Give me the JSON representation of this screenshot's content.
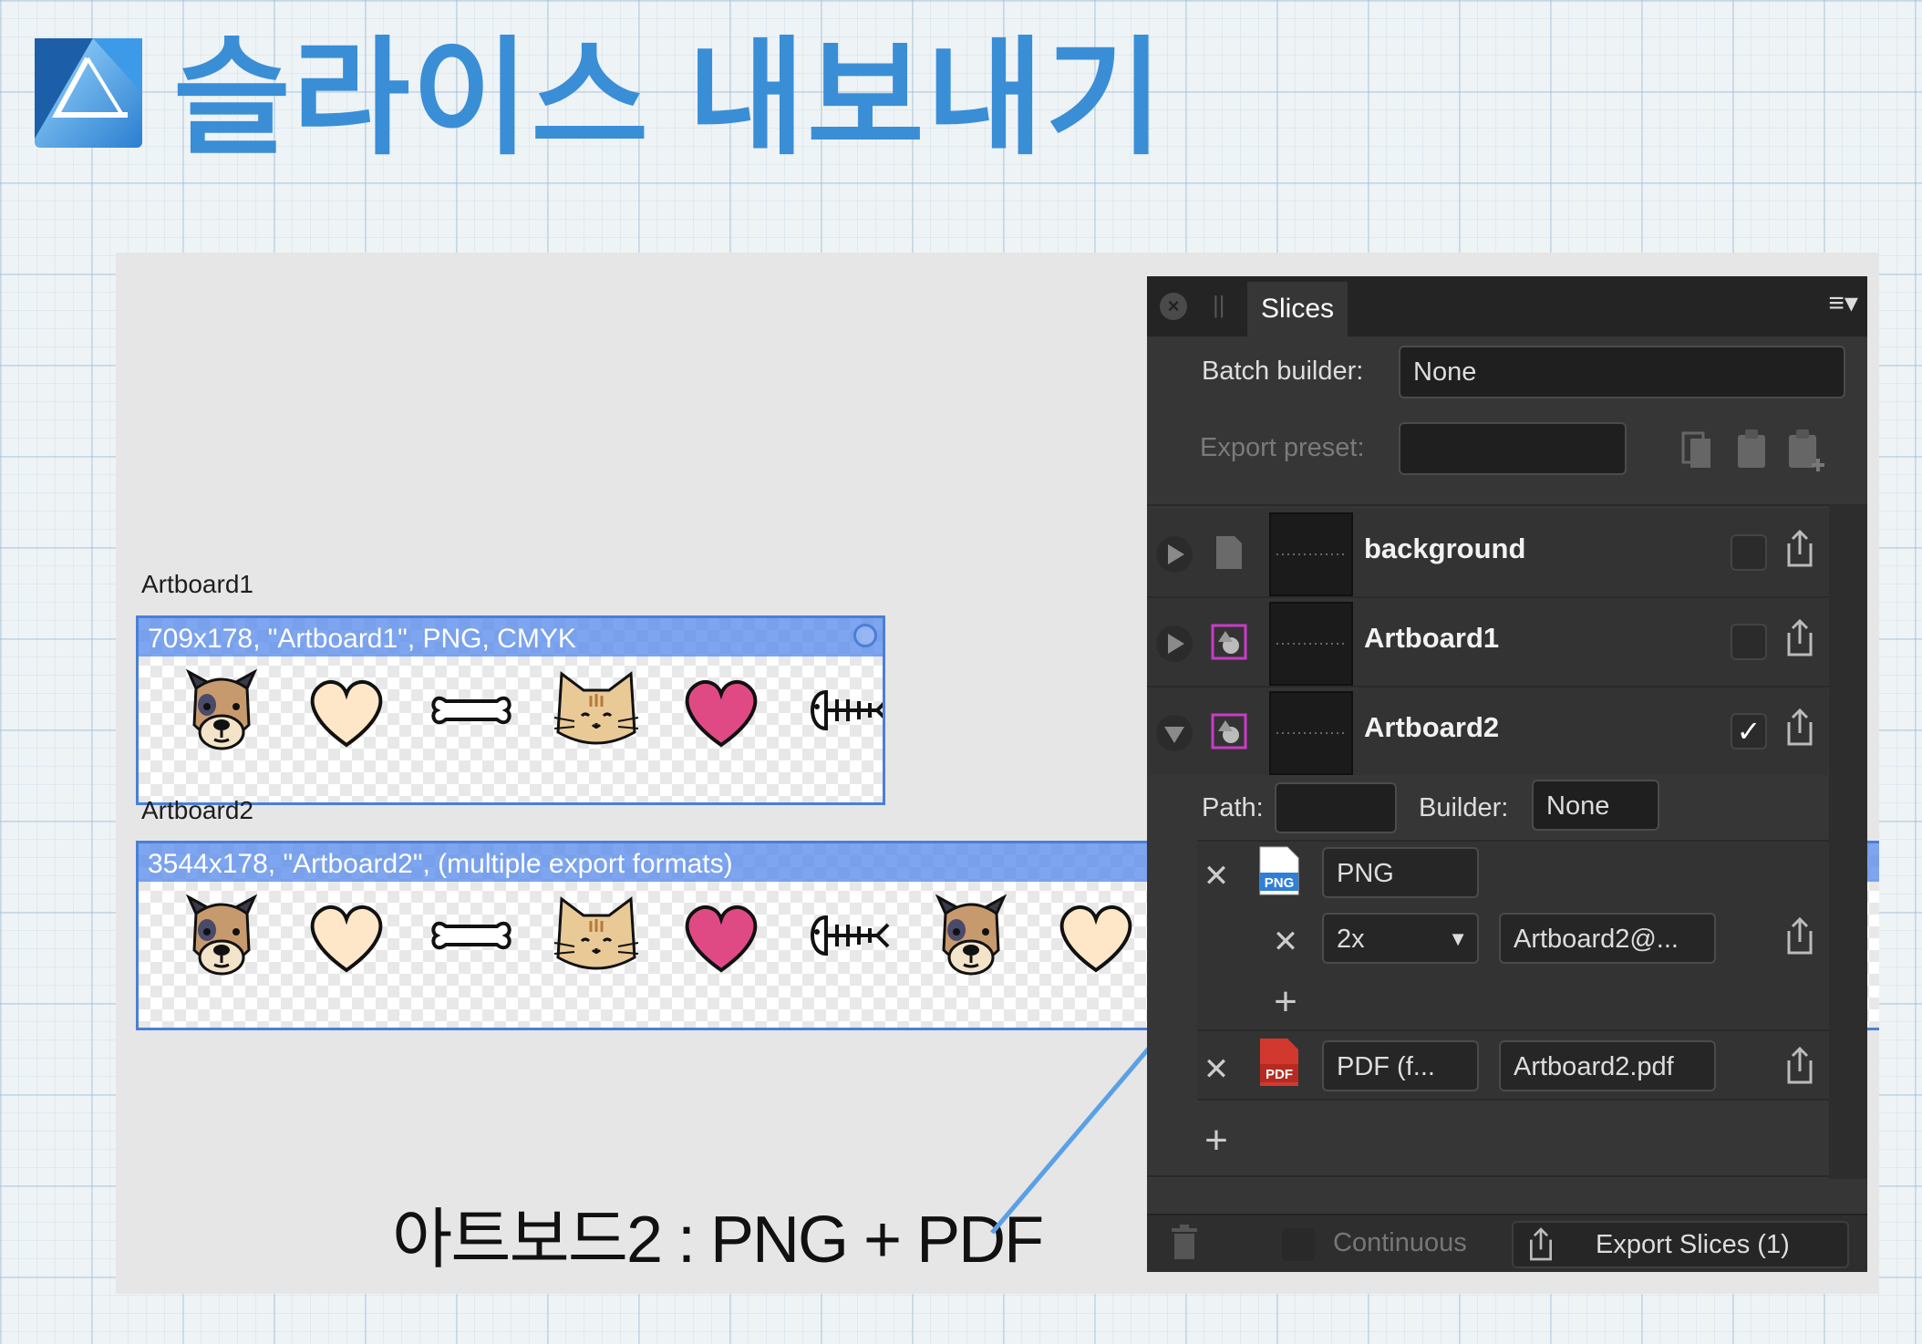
{
  "header": {
    "title": "슬라이스 내보내기"
  },
  "canvas": {
    "artboard1": {
      "label": "Artboard1",
      "info": "709x178, \"Artboard1\", PNG, CMYK"
    },
    "artboard2": {
      "label": "Artboard2",
      "info": "3544x178, \"Artboard2\", (multiple export formats)"
    },
    "icons": [
      "dog-face",
      "cream-heart",
      "bone",
      "cat-face",
      "pink-heart",
      "fish-bone"
    ]
  },
  "annotation": {
    "text": "아트보드2 : PNG + PDF",
    "line_color": "#5aa0e6"
  },
  "panel": {
    "tab": "Slices",
    "batch_builder_label": "Batch builder:",
    "batch_builder_value": "None",
    "export_preset_label": "Export preset:",
    "export_preset_value": "",
    "slices": [
      {
        "name": "background",
        "checked": false,
        "expanded": false
      },
      {
        "name": "Artboard1",
        "checked": false,
        "expanded": false
      },
      {
        "name": "Artboard2",
        "checked": true,
        "expanded": true
      }
    ],
    "path_label": "Path:",
    "path_value": "",
    "builder_label": "Builder:",
    "builder_value": "None",
    "formats": [
      {
        "icon_text": "PNG",
        "format": "PNG",
        "scale": "2x",
        "filename": "Artboard2@..."
      },
      {
        "icon_text": "PDF",
        "format": "PDF (f...",
        "filename": "Artboard2.pdf"
      }
    ],
    "continuous_label": "Continuous",
    "export_button": "Export Slices (1)",
    "checkmark": "✓"
  },
  "colors": {
    "title": "#3a8ed6",
    "artboard_border": "#4a7fd6",
    "panel_bg": "#363636",
    "pdf_red": "#d3382e",
    "png_blue": "#2f7fd8",
    "slice_icon": "#c83cc8"
  }
}
